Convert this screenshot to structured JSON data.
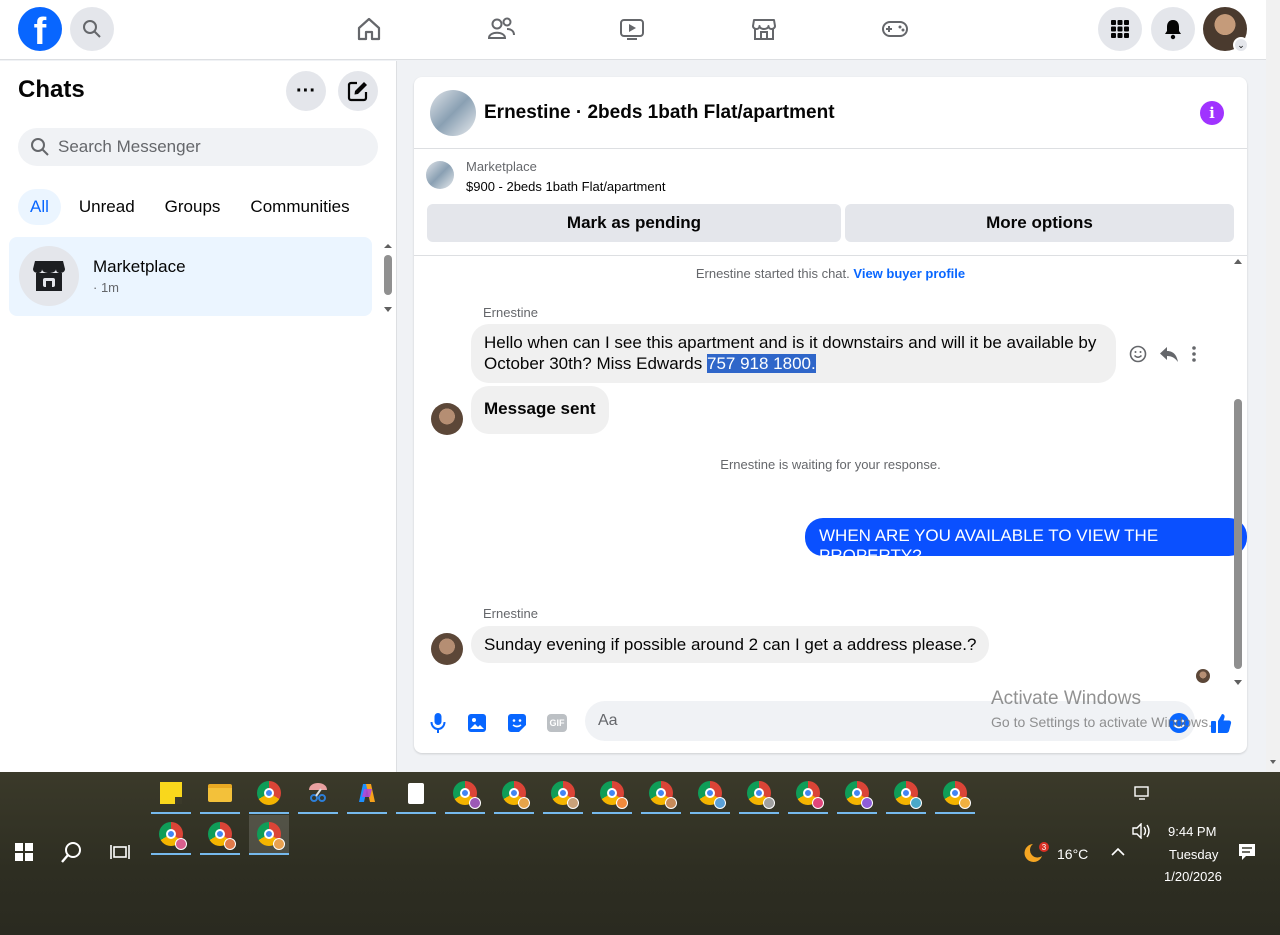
{
  "topnav": {
    "logo_letter": "f",
    "icons": [
      "search-icon",
      "home-icon",
      "friends-icon",
      "watch-icon",
      "marketplace-icon",
      "gaming-icon",
      "menu-grid-icon",
      "notifications-icon"
    ]
  },
  "sidebar": {
    "title": "Chats",
    "search_placeholder": "Search Messenger",
    "filters": [
      "All",
      "Unread",
      "Groups",
      "Communities"
    ],
    "active_filter": "All",
    "chats": [
      {
        "name": "Marketplace",
        "time": "· 1m"
      }
    ]
  },
  "conversation": {
    "title": "Ernestine · 2beds 1bath Flat/apartment",
    "marketplace_label": "Marketplace",
    "listing": "$900 - 2beds 1bath Flat/apartment",
    "mark_pending": "Mark as pending",
    "more_options": "More options",
    "started": "Ernestine started this chat.",
    "view_buyer": "View buyer profile",
    "messages": [
      {
        "sender": "Ernestine",
        "text_line1": "Hello when can I see this apartment and is it downstairs and will it be available by",
        "text_line2": "October 30th? Miss Edwards ",
        "highlighted": "757 918 1800."
      },
      {
        "sender": "",
        "text": "Message sent"
      },
      {
        "sender": "",
        "text": "WHEN ARE YOU AVAILABLE TO VIEW THE PROPERTY?"
      },
      {
        "sender": "Ernestine",
        "text": "Sunday evening if possible around 2 can I get a address please.?"
      }
    ],
    "waiting": "Ernestine is waiting for your response.",
    "input_placeholder": "Aa",
    "gif_label": "GIF"
  },
  "watermark": {
    "line1": "Activate Windows",
    "line2": "Go to Settings to activate Windows."
  },
  "taskbar": {
    "weather_temp": "16°C",
    "weather_badge": "3",
    "time": "9:44 PM",
    "day": "Tuesday",
    "date": "1/20/2026"
  },
  "colors": {
    "accent": "#0866ff",
    "outgoing_bubble": "#0a50ff",
    "info": "#a033ff"
  }
}
